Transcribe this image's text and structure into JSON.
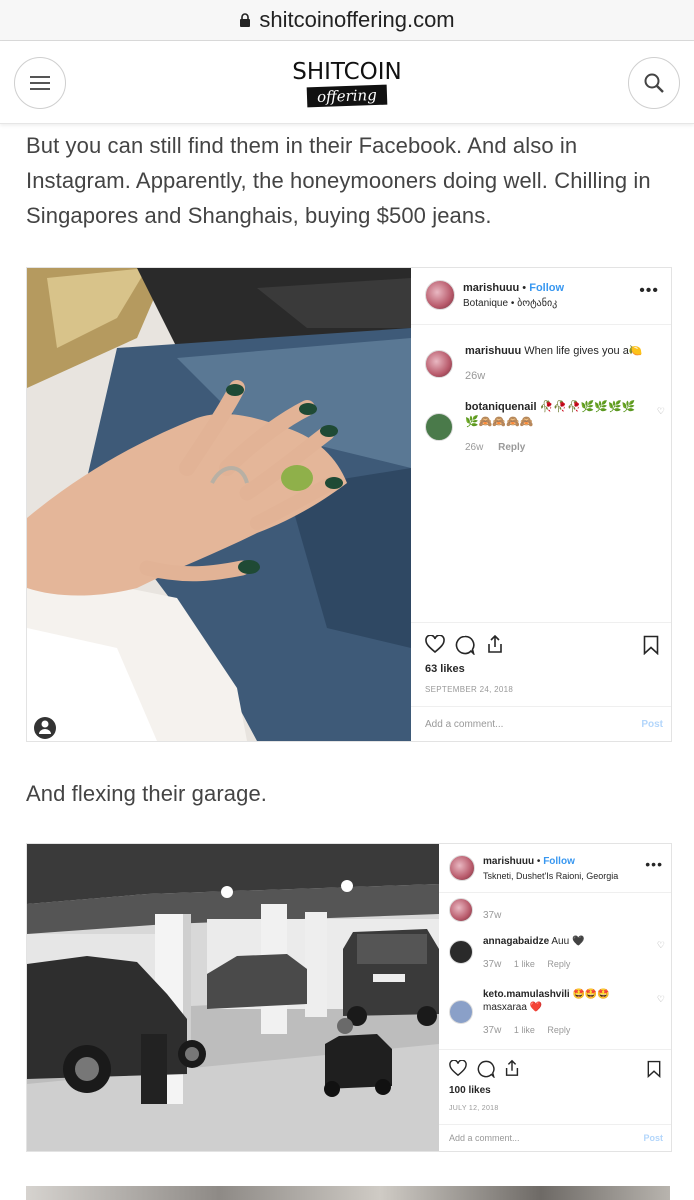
{
  "browser": {
    "url": "shitcoinoffering.com"
  },
  "header": {
    "logo_top": "SHITCOIN",
    "logo_bottom": "offering"
  },
  "article": {
    "paragraph1": "But you can still find them  in their Facebook. And also in Instagram. Apparently, the honeymooners doing well. Chilling in Singapores and Shanghais, buying $500 jeans.",
    "paragraph2": "And flexing their garage."
  },
  "post1": {
    "username": "marishuuu",
    "follow": "Follow",
    "location": "Botanique • ბოტანიკ",
    "comments": [
      {
        "user": "marishuuu",
        "text": "When life gives you a🍋",
        "age": "26w",
        "reply": ""
      },
      {
        "user": "botaniquenail",
        "text": "🥀🥀🥀🌿🌿🌿🌿🌿🙈🙈🙈🙈",
        "age": "26w",
        "reply": "Reply"
      }
    ],
    "likes": "63 likes",
    "date": "SEPTEMBER 24, 2018",
    "add_comment": "Add a comment...",
    "post_label": "Post"
  },
  "post2": {
    "username": "marishuuu",
    "follow": "Follow",
    "location": "Tskneti, Dushet'Is Raioni, Georgia",
    "first_age": "37w",
    "comments": [
      {
        "user": "annagabaidze",
        "text": "Auu 🖤",
        "age": "37w",
        "likes": "1 like",
        "reply": "Reply"
      },
      {
        "user": "keto.mamulashvili",
        "text": "🤩🤩🤩 masxaraa ❤️",
        "age": "37w",
        "likes": "1 like",
        "reply": "Reply"
      }
    ],
    "likes": "100 likes",
    "date": "JULY 12, 2018",
    "add_comment": "Add a comment...",
    "post_label": "Post"
  }
}
